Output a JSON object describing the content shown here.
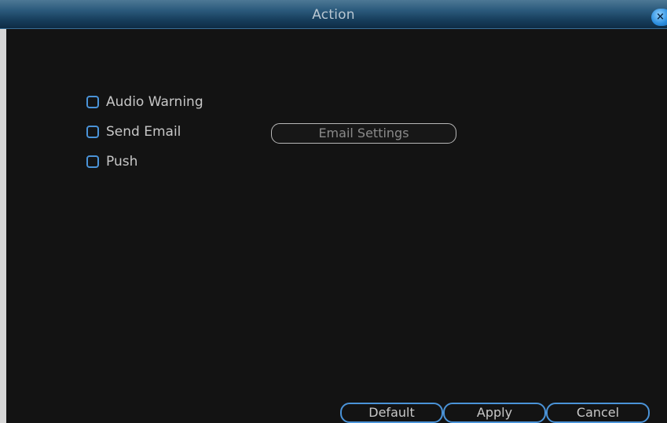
{
  "window": {
    "title": "Action",
    "close_symbol": "×"
  },
  "options": [
    {
      "label": "Audio Warning",
      "checked": false
    },
    {
      "label": "Send Email",
      "checked": false
    },
    {
      "label": "Push",
      "checked": false
    }
  ],
  "email_settings": {
    "label": "Email Settings",
    "enabled": false
  },
  "footer": {
    "default_label": "Default",
    "apply_label": "Apply",
    "cancel_label": "Cancel"
  },
  "colors": {
    "accent": "#4a93d8",
    "background": "#131313",
    "text": "#c7c7c7",
    "disabled_text": "#8a8a8a"
  },
  "icons": {
    "close": "close-icon",
    "checkbox": "checkbox-icon"
  }
}
